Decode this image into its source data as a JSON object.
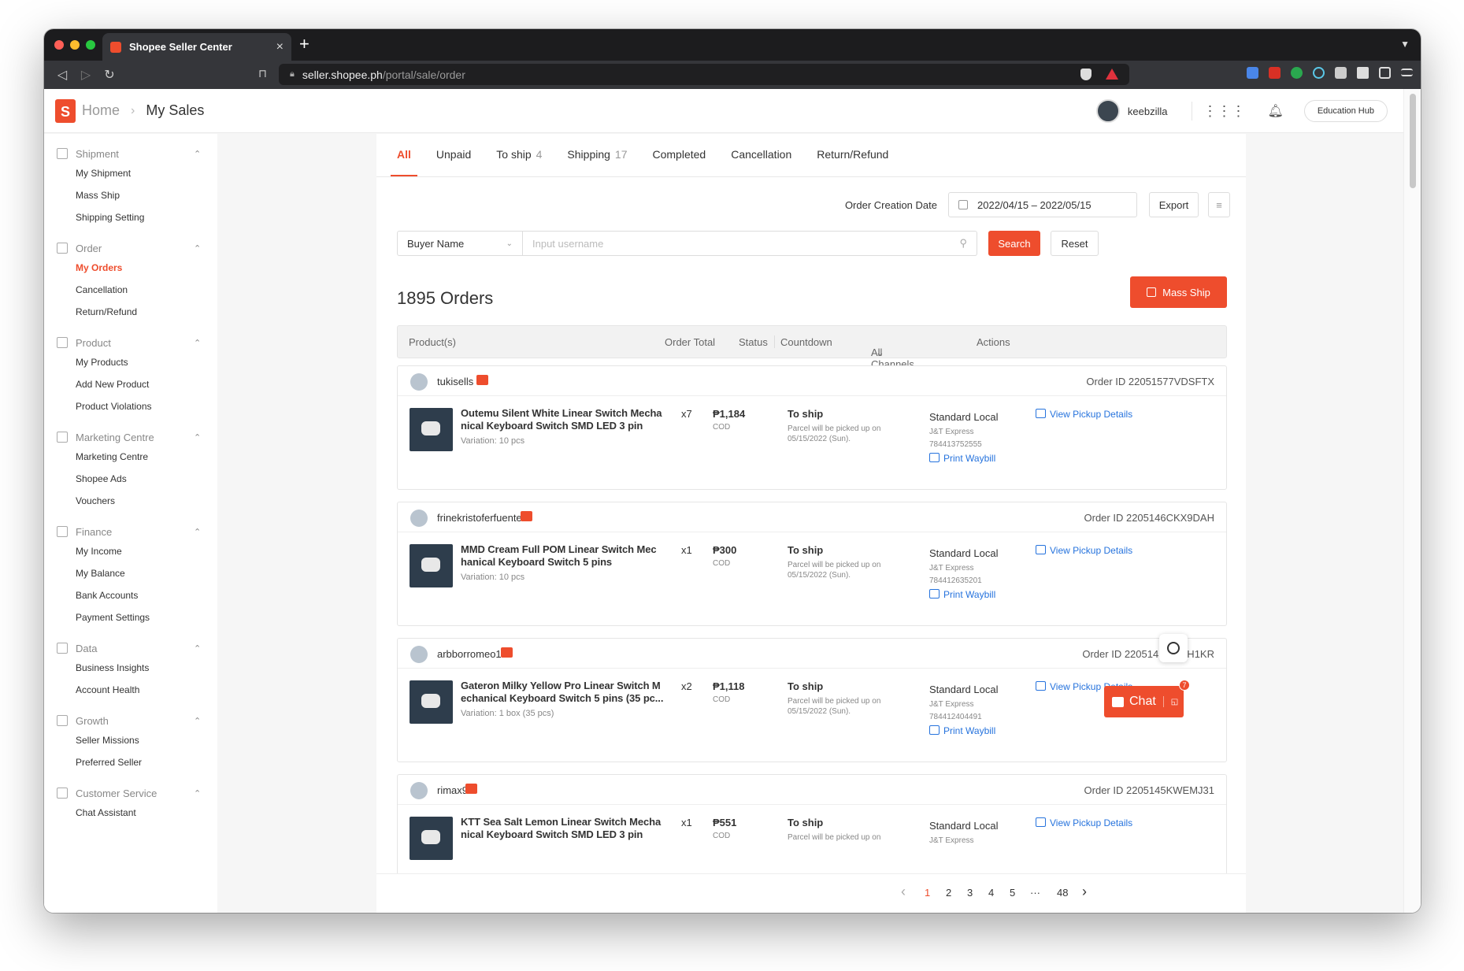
{
  "browser": {
    "tab_title": "Shopee Seller Center",
    "url_host": "seller.shopee.ph",
    "url_path": "/portal/sale/order"
  },
  "header": {
    "logo_letter": "S",
    "breadcrumb_home": "Home",
    "breadcrumb_current": "My Sales",
    "username": "keebzilla",
    "education_hub": "Education Hub"
  },
  "sidebar": {
    "groups": [
      {
        "title": "Shipment",
        "items": [
          "My Shipment",
          "Mass Ship",
          "Shipping Setting"
        ]
      },
      {
        "title": "Order",
        "items": [
          "My Orders",
          "Cancellation",
          "Return/Refund"
        ]
      },
      {
        "title": "Product",
        "items": [
          "My Products",
          "Add New Product",
          "Product Violations"
        ]
      },
      {
        "title": "Marketing Centre",
        "items": [
          "Marketing Centre",
          "Shopee Ads",
          "Vouchers"
        ]
      },
      {
        "title": "Finance",
        "items": [
          "My Income",
          "My Balance",
          "Bank Accounts",
          "Payment Settings"
        ]
      },
      {
        "title": "Data",
        "items": [
          "Business Insights",
          "Account Health"
        ]
      },
      {
        "title": "Growth",
        "items": [
          "Seller Missions",
          "Preferred Seller"
        ]
      },
      {
        "title": "Customer Service",
        "items": [
          "Chat Assistant"
        ]
      }
    ]
  },
  "tabs": [
    {
      "label": "All",
      "count": ""
    },
    {
      "label": "Unpaid",
      "count": ""
    },
    {
      "label": "To ship",
      "count": "4"
    },
    {
      "label": "Shipping",
      "count": "17"
    },
    {
      "label": "Completed",
      "count": ""
    },
    {
      "label": "Cancellation",
      "count": ""
    },
    {
      "label": "Return/Refund",
      "count": ""
    }
  ],
  "filters": {
    "date_label": "Order Creation Date",
    "date_range": "2022/04/15 – 2022/05/15",
    "export": "Export",
    "search_type": "Buyer Name",
    "search_placeholder": "Input username",
    "search": "Search",
    "reset": "Reset"
  },
  "orders_title": "1895 Orders",
  "mass_ship": "Mass Ship",
  "table_headers": {
    "product": "Product(s)",
    "total": "Order Total",
    "status": "Status",
    "countdown": "Countdown",
    "channels": "All Channels",
    "actions": "Actions"
  },
  "orders": [
    {
      "buyer": "tukisells",
      "order_id": "Order ID 22051577VDSFTX",
      "product": "Outemu Silent White Linear Switch Mecha nical Keyboard Switch SMD LED 3 pin",
      "variation": "Variation: 10 pcs",
      "qty": "x7",
      "total": "₱1,184",
      "payment": "COD",
      "status": "To ship",
      "note": "Parcel will be picked up on 05/15/2022 (Sun).",
      "channel": "Standard Local",
      "carrier": "J&T Express",
      "tracking": "784413752555",
      "waybill": "Print Waybill",
      "pickup": "View Pickup Details"
    },
    {
      "buyer": "frinekristoferfuentes",
      "order_id": "Order ID 2205146CKX9DAH",
      "product": "MMD Cream Full POM Linear Switch Mec hanical Keyboard Switch 5 pins",
      "variation": "Variation: 10 pcs",
      "qty": "x1",
      "total": "₱300",
      "payment": "COD",
      "status": "To ship",
      "note": "Parcel will be picked up on 05/15/2022 (Sun).",
      "channel": "Standard Local",
      "carrier": "J&T Express",
      "tracking": "784412635201",
      "waybill": "Print Waybill",
      "pickup": "View Pickup Details"
    },
    {
      "buyer": "arbborromeo13",
      "order_id": "Order ID 2205145RMXH1KR",
      "product": "Gateron Milky Yellow Pro Linear Switch M echanical Keyboard Switch 5 pins (35 pc...",
      "variation": "Variation: 1 box (35 pcs)",
      "qty": "x2",
      "total": "₱1,118",
      "payment": "COD",
      "status": "To ship",
      "note": "Parcel will be picked up on 05/15/2022 (Sun).",
      "channel": "Standard Local",
      "carrier": "J&T Express",
      "tracking": "784412404491",
      "waybill": "Print Waybill",
      "pickup": "View Pickup Details"
    },
    {
      "buyer": "rimax9",
      "order_id": "Order ID 2205145KWEMJ31",
      "product": "KTT Sea Salt Lemon Linear Switch Mecha nical Keyboard Switch SMD LED 3 pin",
      "variation": "",
      "qty": "x1",
      "total": "₱551",
      "payment": "COD",
      "status": "To ship",
      "note": "Parcel will be picked up on",
      "channel": "Standard Local",
      "carrier": "J&T Express",
      "tracking": "",
      "waybill": "",
      "pickup": "View Pickup Details"
    }
  ],
  "pagination": {
    "pages": [
      "1",
      "2",
      "3",
      "4",
      "5",
      "···",
      "48"
    ],
    "prev": "‹",
    "next": "›"
  },
  "chat": {
    "label": "Chat",
    "badge": "7"
  },
  "colors": {
    "brand": "#ee4d2d",
    "link": "#2673dd"
  }
}
